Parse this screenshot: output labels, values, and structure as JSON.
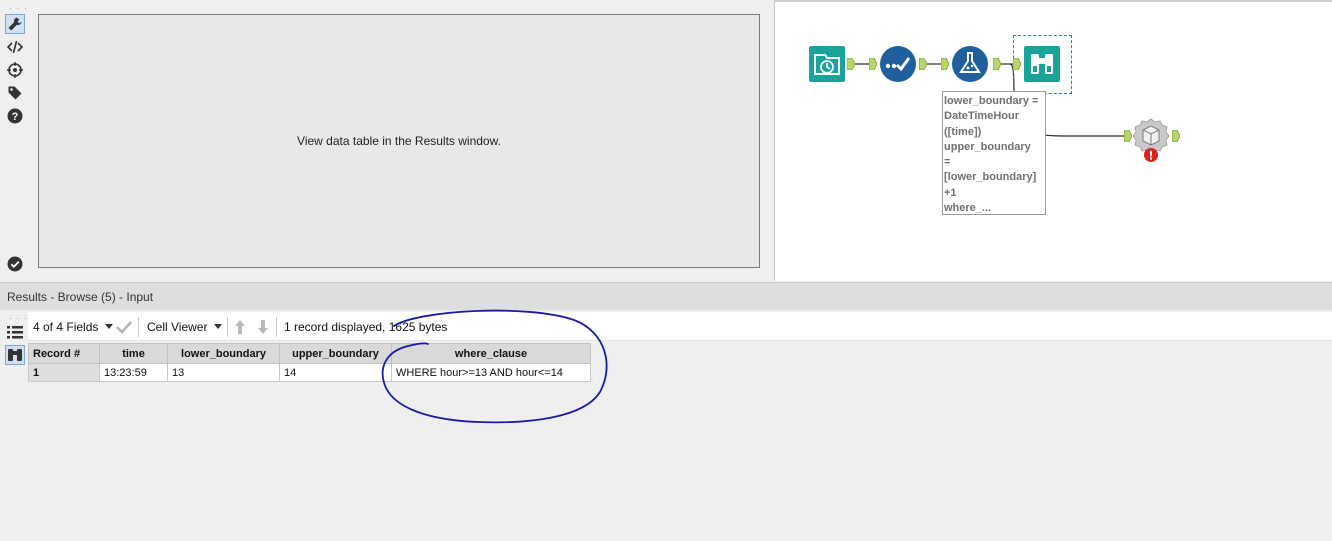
{
  "config": {
    "message": "View data table in the Results window."
  },
  "canvas": {
    "formula_annotation_lines": [
      "lower_boundary =",
      "DateTimeHour",
      "([time])",
      "upper_boundary",
      "=",
      "[lower_boundary]",
      "+1",
      "where_..."
    ],
    "colors": {
      "input_tool": "#1aa39a",
      "select_tool": "#1f5f9d",
      "formula_tool": "#1f5f9d",
      "browse_tool": "#1aa39a",
      "anchor": "#b8d56a",
      "error": "#d9241c",
      "selection": "#2a7ab8"
    },
    "tools": [
      "input-data-icon",
      "select-icon",
      "formula-icon",
      "browse-icon",
      "dynamic-input-icon"
    ]
  },
  "results": {
    "title": "Results - Browse (5) - Input",
    "fields_selector": "4 of 4 Fields",
    "viewer_selector": "Cell Viewer",
    "record_info": "1 record displayed, 1625 bytes",
    "columns": [
      "Record #",
      "time",
      "lower_boundary",
      "upper_boundary",
      "where_clause"
    ],
    "rows": [
      [
        "1",
        "13:23:59",
        "13",
        "14",
        "WHERE hour>=13 AND hour<=14"
      ]
    ]
  }
}
